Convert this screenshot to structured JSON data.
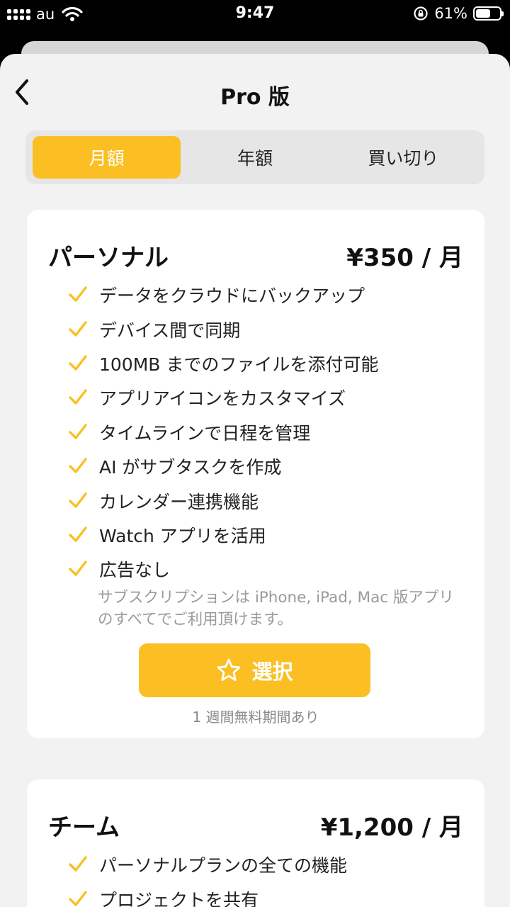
{
  "status_bar": {
    "carrier": "au",
    "time": "9:47",
    "battery": "61%",
    "battery_level": 0.61
  },
  "nav": {
    "title": "Pro 版",
    "back_icon": "chevron-left-icon"
  },
  "tabs": [
    {
      "label": "月額",
      "active": true
    },
    {
      "label": "年額",
      "active": false
    },
    {
      "label": "買い切り",
      "active": false
    }
  ],
  "plans": [
    {
      "name": "パーソナル",
      "price": "¥350 / 月",
      "features": [
        "データをクラウドにバックアップ",
        "デバイス間で同期",
        "100MB までのファイルを添付可能",
        "アプリアイコンをカスタマイズ",
        "タイムラインで日程を管理",
        "AI がサブタスクを作成",
        "カレンダー連携機能",
        "Watch アプリを活用",
        "広告なし"
      ],
      "note": "サブスクリプションは iPhone, iPad, Mac 版アプリのすべてでご利用頂けます。",
      "button_label": "選択",
      "trial": "1 週間無料期間あり"
    },
    {
      "name": "チーム",
      "price": "¥1,200 / 月",
      "features": [
        "パーソナルプランの全ての機能",
        "プロジェクトを共有"
      ]
    }
  ],
  "colors": {
    "accent": "#fbbf24",
    "background": "#f2f2f2",
    "card": "#ffffff"
  }
}
